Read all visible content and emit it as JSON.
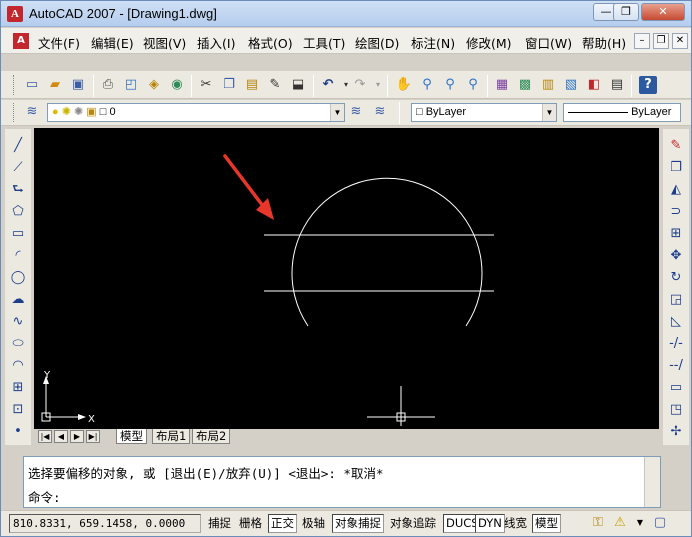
{
  "window": {
    "title": "AutoCAD 2007 - [Drawing1.dwg]",
    "logo_letter": "A",
    "buttons": {
      "minimize": "—",
      "restore": "❐",
      "close": "✕"
    }
  },
  "menu": {
    "items": [
      "文件(F)",
      "编辑(E)",
      "视图(V)",
      "插入(I)",
      "格式(O)",
      "工具(T)",
      "绘图(D)",
      "标注(N)",
      "修改(M)",
      "窗口(W)",
      "帮助(H)"
    ],
    "mdi_buttons": {
      "minimize": "–",
      "restore": "❐",
      "close": "✕"
    }
  },
  "layers": {
    "current_layer": "0",
    "color_combo": "ByLayer",
    "linetype_combo": "ByLayer"
  },
  "layout_tabs": [
    "模型",
    "布局1",
    "布局2"
  ],
  "command": {
    "history": "选择要偏移的对象, 或 [退出(E)/放弃(U)] <退出>:  *取消*",
    "prompt": "命令:",
    "input": ""
  },
  "status": {
    "coordinates": "810.8331, 659.1458, 0.0000",
    "toggles": [
      {
        "label": "捕捉",
        "on": false
      },
      {
        "label": "栅格",
        "on": false
      },
      {
        "label": "正交",
        "on": true
      },
      {
        "label": "极轴",
        "on": false
      },
      {
        "label": "对象捕捉",
        "on": true
      },
      {
        "label": "对象追踪",
        "on": false
      },
      {
        "label": "DUCS",
        "on": true
      },
      {
        "label": "DYN",
        "on": true
      },
      {
        "label": "线宽",
        "on": false
      },
      {
        "label": "模型",
        "on": true
      }
    ]
  },
  "ucs": {
    "x_label": "X",
    "y_label": "Y"
  },
  "colors": {
    "canvas": "#000000",
    "geometry": "#ffffff",
    "arrow": "#e8362a"
  }
}
